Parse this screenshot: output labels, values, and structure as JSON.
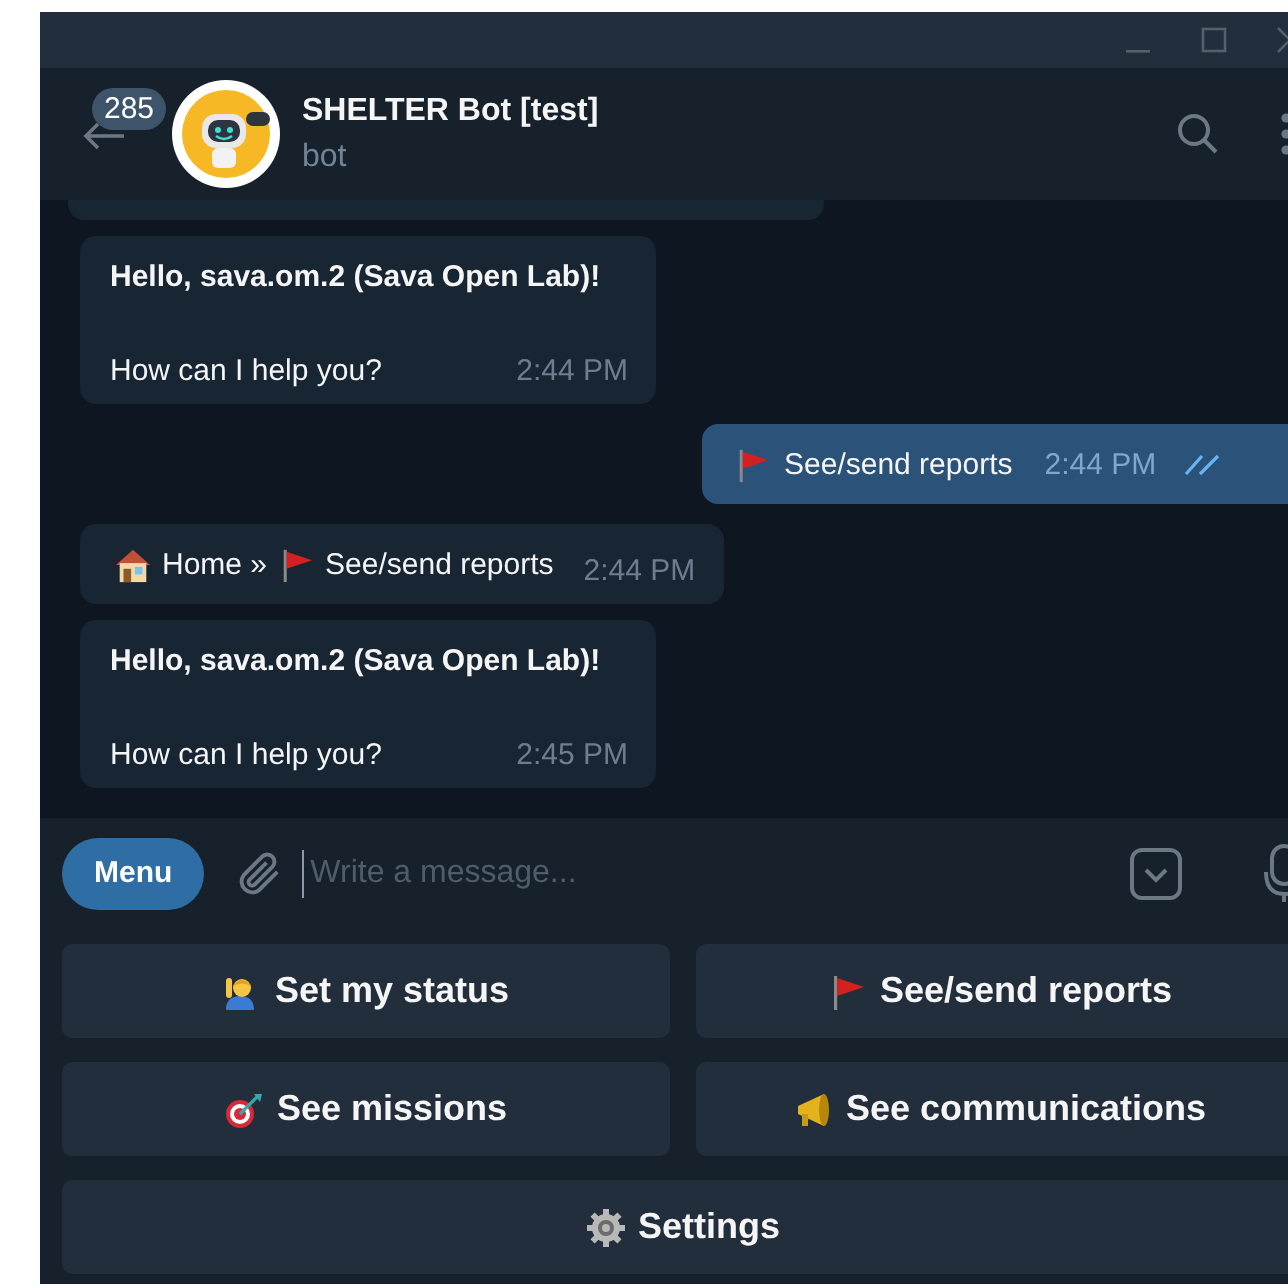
{
  "header": {
    "unread_count": "285",
    "title": "SHELTER Bot [test]",
    "subtitle": "bot"
  },
  "messages": [
    {
      "kind": "incoming",
      "title": "Hello, sava.om.2 (Sava Open Lab)!",
      "text": "How can I help you?",
      "time": "2:44 PM"
    },
    {
      "kind": "outgoing",
      "text": "See/send reports",
      "time": "2:44 PM",
      "read": true
    },
    {
      "kind": "breadcrumb",
      "home": "Home »",
      "text": "See/send reports",
      "time": "2:44 PM"
    },
    {
      "kind": "incoming",
      "title": "Hello, sava.om.2 (Sava Open Lab)!",
      "text": "How can I help you?",
      "time": "2:45 PM"
    }
  ],
  "composer": {
    "menu": "Menu",
    "placeholder": "Write a message..."
  },
  "keyboard": [
    [
      {
        "label": "Set my status"
      },
      {
        "label": "See/send reports"
      }
    ],
    [
      {
        "label": "See missions"
      },
      {
        "label": "See communications"
      }
    ],
    [
      {
        "label": "Settings"
      }
    ]
  ]
}
